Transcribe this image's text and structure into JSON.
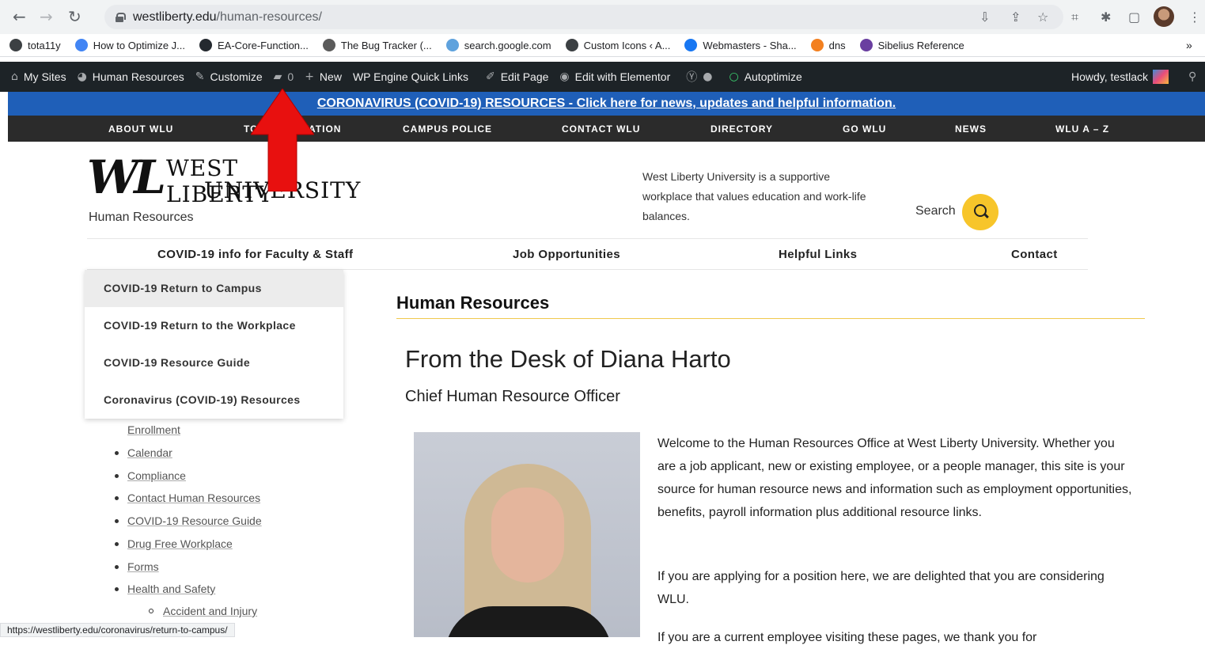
{
  "browser": {
    "url_domain": "westliberty.edu",
    "url_path": "/human-resources/",
    "status_url": "https://westliberty.edu/coronavirus/return-to-campus/"
  },
  "bookmarks": [
    {
      "label": "tota11y",
      "color": "#3c4043"
    },
    {
      "label": "How to Optimize J...",
      "color": "#4285f4"
    },
    {
      "label": "EA-Core-Function...",
      "color": "#24292f"
    },
    {
      "label": "The Bug Tracker (...",
      "color": "#5b5b5b"
    },
    {
      "label": "search.google.com",
      "color": "#5fa2dd"
    },
    {
      "label": "Custom Icons ‹ A...",
      "color": "#3c4043"
    },
    {
      "label": "Webmasters - Sha...",
      "color": "#1877f2"
    },
    {
      "label": "dns",
      "color": "#f38020"
    },
    {
      "label": "Sibelius Reference",
      "color": "#6a3fa0"
    }
  ],
  "bookmarks_more": "»",
  "admin_bar": {
    "my_sites": "My Sites",
    "site_name": "Human Resources",
    "customize": "Customize",
    "comments_count": "0",
    "new": "New",
    "wp_engine": "WP Engine Quick Links",
    "edit_page": "Edit Page",
    "edit_elementor": "Edit with Elementor",
    "autoptimize": "Autoptimize",
    "howdy": "Howdy, testlack"
  },
  "covid_banner": "CORONAVIRUS (COVID-19) RESOURCES - Click here for news, updates and helpful information.",
  "site_nav": [
    "ABOUT WLU",
    "TOP ORIENTATION",
    "CAMPUS POLICE",
    "CONTACT WLU",
    "DIRECTORY",
    "GO WLU",
    "NEWS",
    "WLU A – Z"
  ],
  "logo": {
    "mark": "WL",
    "line1": "WEST LIBERTY",
    "line2": "UNIVERSITY",
    "subtitle": "Human Resources"
  },
  "tagline": "West Liberty University is a supportive workplace that values education and work-life balances.",
  "search_label": "Search",
  "sub_nav": [
    "COVID-19 info for Faculty & Staff",
    "Job Opportunities",
    "Helpful Links",
    "Contact"
  ],
  "dropdown": [
    "COVID-19 Return to Campus",
    "COVID-19 Return to the Workplace",
    "COVID-19 Resource Guide",
    "Coronavirus (COVID-19) Resources"
  ],
  "sidebar": {
    "partial": "Enrollment",
    "items": [
      "Calendar",
      "Compliance",
      "Contact Human Resources",
      "COVID-19 Resource Guide",
      "Drug Free Workplace",
      "Forms",
      "Health and Safety"
    ],
    "subitem": "Accident and Injury"
  },
  "main": {
    "heading": "Human Resources",
    "title": "From the Desk of Diana Harto",
    "subtitle": "Chief Human Resource Officer",
    "para1": "Welcome to the Human Resources Office at West Liberty University. Whether you are a job applicant, new or existing employee, or a people manager, this site is your source for human resource news and information such as employment opportunities, benefits, payroll information plus additional resource links.",
    "para2": "If you are applying for a position here, we are delighted that you are considering WLU.",
    "para3": "If you are a current employee visiting these pages, we thank you for"
  },
  "colors": {
    "admin_bar": "#1d2327",
    "banner": "#1f5fb8",
    "accent_gold": "#f7c52a",
    "annotation_arrow": "#e8100f"
  }
}
